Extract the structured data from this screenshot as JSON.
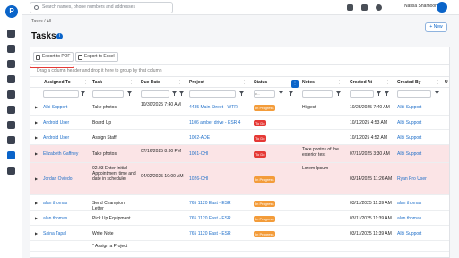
{
  "search": {
    "placeholder": "Search names, phone numbers and addresses"
  },
  "user": {
    "name": "Nafisa Shamoon"
  },
  "breadcrumb": "Tasks / All",
  "page_title": "Tasks",
  "new_button": "+ New",
  "toolbar": {
    "export_pdf": "Export to PDF",
    "export_excel": "Export to Excel"
  },
  "group_hint": "Drag a column header and drop it here to group by that column",
  "columns": [
    "Assigned To",
    "Task",
    "Due Date",
    "Project",
    "Status",
    "Notes",
    "Created At",
    "Created By",
    "U"
  ],
  "filters": {
    "status_value": "c..."
  },
  "colors": {
    "accent": "#0a64c9",
    "in_progress": "#f39c3a",
    "todo": "#e53935",
    "highlight_row": "#fbe4e6"
  },
  "rows": [
    {
      "assigned": "Albi Support",
      "task": "Take photos",
      "due": "10/30/2025 7:40 AM",
      "project": "4435 Main Street - WTR",
      "status": "In Progress",
      "notes": "Hi gest",
      "created_at": "10/28/2025 7:40 AM",
      "created_by": "Albi Support"
    },
    {
      "assigned": "Android User",
      "task": "Board Up",
      "due": "",
      "project": "1106 amber drive - ESR 4",
      "status": "To Do",
      "notes": "",
      "created_at": "10/1/2025 4:53 AM",
      "created_by": "Albi Support"
    },
    {
      "assigned": "Android User",
      "task": "Assign Staff",
      "due": "",
      "project": "1002-ADE",
      "status": "To Do",
      "notes": "",
      "created_at": "10/1/2025 4:52 AM",
      "created_by": "Albi Support"
    },
    {
      "assigned": "Elizabeth Gaffney",
      "task": "Take photos",
      "due": "07/16/2025 8:30 PM",
      "project": "1001-CHI",
      "status": "To Do",
      "notes": "Take photos of the exterior test",
      "created_at": "07/16/2025 3:30 AM",
      "created_by": "Albi Support"
    },
    {
      "assigned": "Jordan Oviedo",
      "task": "02.03 Enter Initial Appointment time and date in scheduler",
      "due": "04/02/2025 10:00 AM",
      "project": "1026-CHI",
      "status": "In Progress",
      "notes": "Lorem Ipsum",
      "created_at": "03/14/2025 11:26 AM",
      "created_by": "Ryan Pro User"
    },
    {
      "assigned": "alan thomas",
      "task": "Send Champion Letter",
      "due": "",
      "project": "765 1120 East - ESR",
      "status": "In Progress",
      "notes": "",
      "created_at": "03/11/2025 11:39 AM",
      "created_by": "alan thomas"
    },
    {
      "assigned": "alan thomas",
      "task": "Pick Up Equipment",
      "due": "",
      "project": "765 1120 East - ESR",
      "status": "In Progress",
      "notes": "",
      "created_at": "03/11/2025 11:39 AM",
      "created_by": "alan thomas"
    },
    {
      "assigned": "Saina Tapal",
      "task": "Write Note",
      "due": "",
      "project": "765 1120 East - ESR",
      "status": "In Progress",
      "notes": "",
      "created_at": "03/11/2025 11:39 AM",
      "created_by": "Albi Support"
    },
    {
      "assigned": "",
      "task": "* Assign a Project",
      "due": "",
      "project": "",
      "status": "",
      "notes": "",
      "created_at": "",
      "created_by": ""
    }
  ]
}
